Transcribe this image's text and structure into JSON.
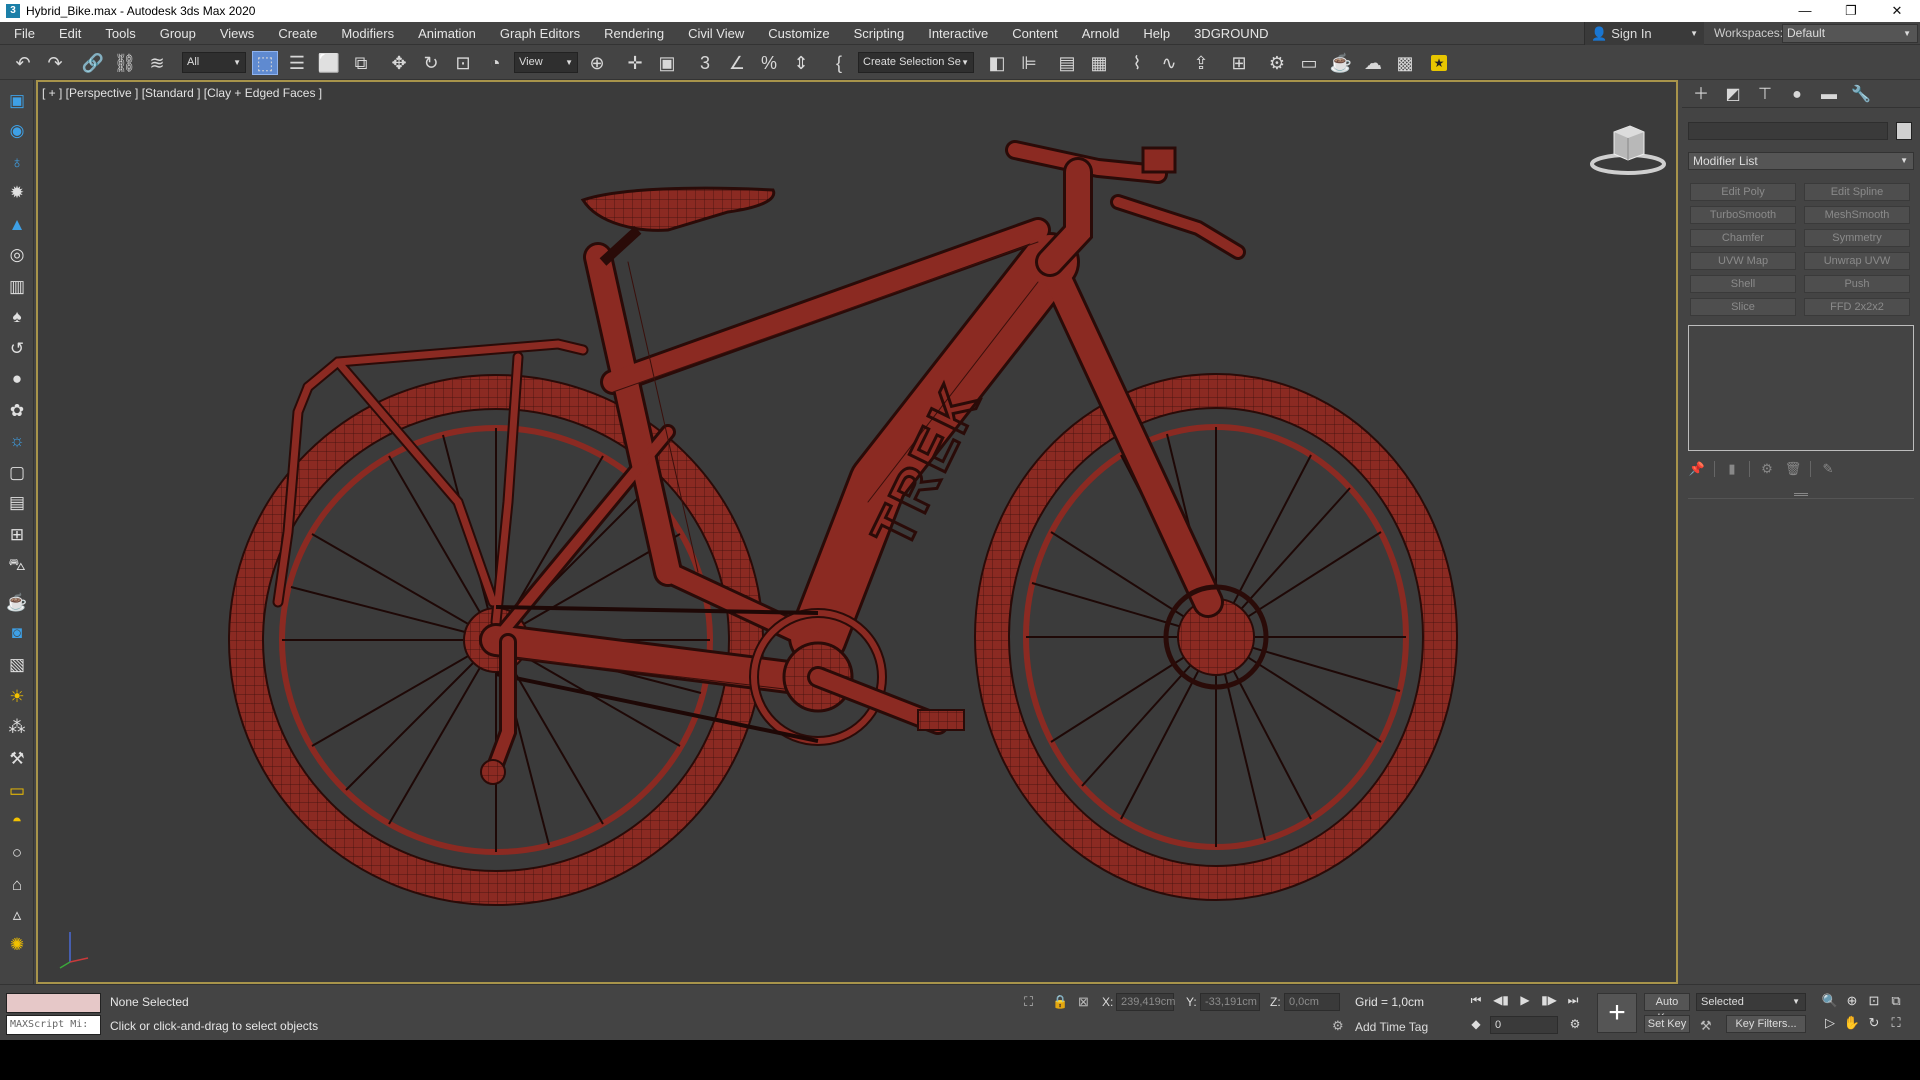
{
  "window": {
    "title": "Hybrid_Bike.max - Autodesk 3ds Max 2020",
    "app_icon": "3",
    "controls": [
      "—",
      "❐",
      "✕"
    ]
  },
  "menu": [
    "File",
    "Edit",
    "Tools",
    "Group",
    "Views",
    "Create",
    "Modifiers",
    "Animation",
    "Graph Editors",
    "Rendering",
    "Civil View",
    "Customize",
    "Scripting",
    "Interactive",
    "Content",
    "Arnold",
    "Help",
    "3DGROUND"
  ],
  "account": {
    "sign_in": "Sign In",
    "workspaces_label": "Workspaces:",
    "workspace": "Default"
  },
  "toolbar": {
    "selection_filter": "All",
    "ref_coord": "View",
    "selection_set": "Create Selection Se",
    "icons": [
      "undo-icon",
      "redo-icon",
      "link-icon",
      "unlink-icon",
      "bind-spacewarp-icon",
      "select-object-icon",
      "select-by-name-icon",
      "rect-region-icon",
      "window-crossing-icon",
      "move-icon",
      "rotate-icon",
      "scale-icon",
      "placement-icon",
      "pivot-icon",
      "manipulate-icon",
      "snap-icon",
      "angle-snap-icon",
      "percent-snap-icon",
      "spinner-snap-icon",
      "named-sets-icon",
      "mirror-icon",
      "align-icon",
      "layer-explorer-icon",
      "ribbon-icon",
      "curve-editor-icon",
      "schematic-icon",
      "material-editor-icon",
      "render-setup-icon",
      "rendered-frame-icon",
      "render-icon",
      "render-cloud-icon",
      "render-iterative-icon",
      "viewport-layout-icon",
      "3dground-icon"
    ]
  },
  "viewport": {
    "label": "[ + ] [Perspective ] [Standard ] [Clay + Edged Faces ]",
    "brand_text": "TREK",
    "colors": {
      "mesh": "#8b2a22",
      "wire": "#2a0b08",
      "background": "#3b3b3b",
      "border": "#a8944b"
    }
  },
  "command_panel": {
    "modifier_list": "Modifier List",
    "modifiers": [
      "Edit Poly",
      "Edit Spline",
      "TurboSmooth",
      "MeshSmooth",
      "Chamfer",
      "Symmetry",
      "UVW Map",
      "Unwrap UVW",
      "Shell",
      "Push",
      "Slice",
      "FFD 2x2x2"
    ]
  },
  "status": {
    "maxscript_placeholder": "MAXScript Mi:",
    "selection": "None Selected",
    "prompt": "Click or click-and-drag to select objects",
    "x_label": "X:",
    "x_value": "239,419cm",
    "y_label": "Y:",
    "y_value": "-33,191cm",
    "z_label": "Z:",
    "z_value": "0,0cm",
    "grid": "Grid = 1,0cm",
    "add_time_tag": "Add Time Tag",
    "frame": "0",
    "auto_key": "Auto Key",
    "set_key": "Set Key",
    "key_mode": "Selected",
    "key_filters": "Key Filters..."
  }
}
